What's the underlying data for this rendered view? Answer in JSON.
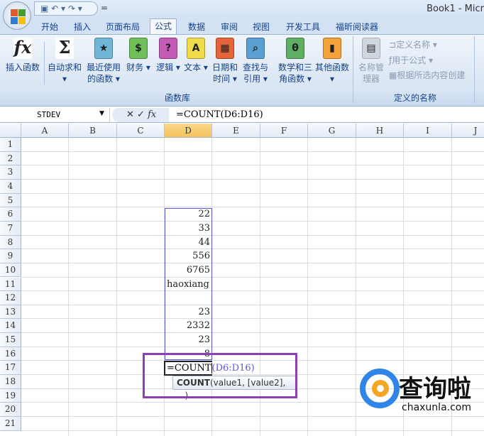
{
  "window": {
    "title": "Book1 - Micr"
  },
  "qat": {
    "items": [
      "save-icon",
      "undo-icon",
      "redo-icon"
    ],
    "customize": "="
  },
  "tabs": [
    "开始",
    "插入",
    "页面布局",
    "公式",
    "数据",
    "审阅",
    "视图",
    "开发工具",
    "福昕阅读器"
  ],
  "active_tab": "公式",
  "ribbon": {
    "buttons": [
      {
        "label": "插入函数",
        "icon": "fx",
        "color": "#ffffff"
      },
      {
        "label": "自动求和 ▾",
        "icon": "Σ",
        "color": "#ffffff"
      },
      {
        "label": "最近使用的函数 ▾",
        "icon": "★",
        "color": "#6fb6d8"
      },
      {
        "label": "财务 ▾",
        "icon": "$",
        "color": "#6fbf5a"
      },
      {
        "label": "逻辑 ▾",
        "icon": "?",
        "color": "#c45bb6"
      },
      {
        "label": "文本 ▾",
        "icon": "A",
        "color": "#f0dc4a"
      },
      {
        "label": "日期和时间 ▾",
        "icon": "▦",
        "color": "#e5643a"
      },
      {
        "label": "查找与引用 ▾",
        "icon": "⌕",
        "color": "#5b9fd3"
      },
      {
        "label": "数学和三角函数 ▾",
        "icon": "θ",
        "color": "#5fae63"
      },
      {
        "label": "其他函数 ▾",
        "icon": "▮",
        "color": "#f6a23a"
      }
    ],
    "group1": "函数库",
    "name_manager": "名称管理器",
    "define_name": "定义名称 ▾",
    "use_in_formula": "用于公式 ▾",
    "create_from_selection": "根据所选内容创建",
    "group2": "定义的名称"
  },
  "formula_bar": {
    "name_box": "STDEV",
    "cancel": "✕",
    "enter": "✓",
    "fx": "fx",
    "formula": "=COUNT(D6:D16)"
  },
  "columns": [
    "A",
    "B",
    "C",
    "D",
    "E",
    "F",
    "G",
    "H",
    "I",
    "J"
  ],
  "selected_column": "D",
  "rows": [
    "1",
    "2",
    "3",
    "4",
    "5",
    "6",
    "7",
    "8",
    "9",
    "10",
    "11",
    "12",
    "13",
    "14",
    "15",
    "16",
    "17",
    "18",
    "19",
    "20",
    "21"
  ],
  "cells": [
    {
      "row": 6,
      "value": "22"
    },
    {
      "row": 7,
      "value": "33"
    },
    {
      "row": 8,
      "value": "44"
    },
    {
      "row": 9,
      "value": "556"
    },
    {
      "row": 10,
      "value": "6765"
    },
    {
      "row": 11,
      "value": "haoxiang",
      "align": "left"
    },
    {
      "row": 13,
      "value": "23"
    },
    {
      "row": 14,
      "value": "2332"
    },
    {
      "row": 15,
      "value": "23"
    },
    {
      "row": 16,
      "value": "8"
    }
  ],
  "editing": {
    "func": "=COUNT",
    "args": "(D6:D16)"
  },
  "tooltip": {
    "func": "COUNT",
    "args": "(value1, [value2], ...)"
  },
  "watermark": {
    "text": "查询啦",
    "url": "chaxunla.com"
  },
  "colors": {
    "highlight": "#8d3fb8",
    "range": "#5a5ad6"
  }
}
